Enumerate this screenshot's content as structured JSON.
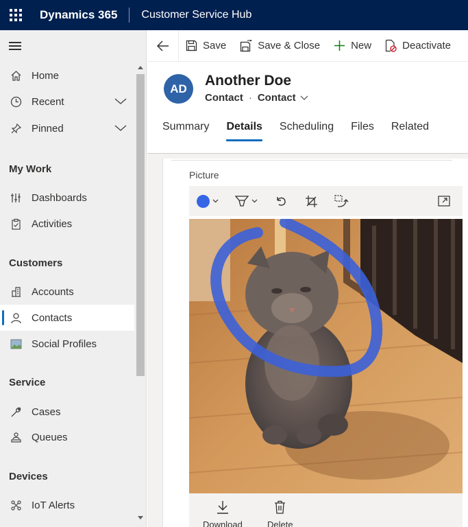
{
  "topbar": {
    "brand": "Dynamics 365",
    "app_name": "Customer Service Hub"
  },
  "sidebar": {
    "items_top": [
      {
        "label": "Home",
        "icon": "home-icon"
      },
      {
        "label": "Recent",
        "icon": "clock-icon"
      },
      {
        "label": "Pinned",
        "icon": "pin-icon"
      }
    ],
    "groups": [
      {
        "title": "My Work",
        "items": [
          {
            "label": "Dashboards"
          },
          {
            "label": "Activities"
          }
        ]
      },
      {
        "title": "Customers",
        "items": [
          {
            "label": "Accounts"
          },
          {
            "label": "Contacts",
            "selected": true
          },
          {
            "label": "Social Profiles"
          }
        ]
      },
      {
        "title": "Service",
        "items": [
          {
            "label": "Cases"
          },
          {
            "label": "Queues"
          }
        ]
      },
      {
        "title": "Devices",
        "items": [
          {
            "label": "IoT Alerts"
          }
        ]
      }
    ]
  },
  "commands": {
    "save": "Save",
    "save_close": "Save & Close",
    "new": "New",
    "deactivate": "Deactivate"
  },
  "record": {
    "initials": "AD",
    "name": "Another Doe",
    "entity": "Contact",
    "form": "Contact",
    "avatar_color": "#2f63a8"
  },
  "tabs": [
    {
      "label": "Summary"
    },
    {
      "label": "Details",
      "active": true
    },
    {
      "label": "Scheduling"
    },
    {
      "label": "Files"
    },
    {
      "label": "Related"
    }
  ],
  "picture": {
    "label": "Picture",
    "pen_color": "#3566e6",
    "download": "Download",
    "delete": "Delete"
  }
}
